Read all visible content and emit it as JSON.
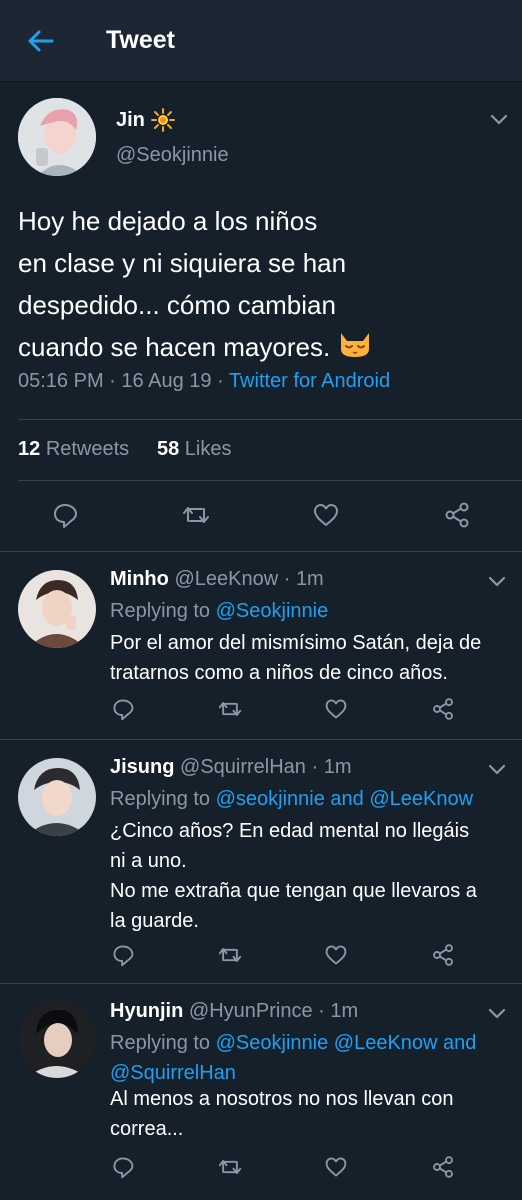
{
  "header": {
    "title": "Tweet"
  },
  "main_tweet": {
    "name": "Jin",
    "name_emoji": "sun-emoji",
    "handle": "@Seokjinnie",
    "text_line1": "Hoy he dejado a los niños",
    "text_line2": "en clase y ni siquiera se han",
    "text_line3": "despedido... cómo cambian",
    "text_line4": "cuando se hacen mayores.",
    "text_emoji": "sleepy-cat-emoji",
    "time": "05:16 PM",
    "date": "16 Aug 19",
    "client": "Twitter for Android",
    "retweets_count": "12",
    "retweets_label": "Retweets",
    "likes_count": "58",
    "likes_label": "Likes"
  },
  "replies": [
    {
      "name": "Minho",
      "handle": "@LeeKnow",
      "age": "1m",
      "replying_prefix": "Replying to",
      "replying_to": "@Seokjinnie",
      "line1": "Por el amor del mismísimo Satán, deja de",
      "line2": "tratarnos como a niños de cinco años."
    },
    {
      "name": "Jisung",
      "handle": "@SquirrelHan",
      "age": "1m",
      "replying_prefix": "Replying to",
      "replying_to": "@seokjinnie and @LeeKnow",
      "line1": "¿Cinco años? En edad mental no llegáis",
      "line2": "ni a uno.",
      "line3": "No me extraña que tengan que llevaros a",
      "line4": "la guarde."
    },
    {
      "name": "Hyunjin",
      "handle": "@HyunPrince",
      "age": "1m",
      "replying_prefix": "Replying to",
      "replying_to_line1": "@Seokjinnie @LeeKnow and",
      "replying_to_line2": "@SquirrelHan",
      "line1": "Al menos a nosotros no nos llevan con",
      "line2": "correa..."
    }
  ],
  "separator": "·",
  "colors": {
    "background": "#15202b",
    "header": "#1c2733",
    "accent": "#1da1f2",
    "muted": "#8899a6",
    "divider": "#38444d"
  },
  "icons": [
    "back-arrow-icon",
    "chevron-down-icon",
    "reply-icon",
    "retweet-icon",
    "like-icon",
    "share-icon"
  ]
}
